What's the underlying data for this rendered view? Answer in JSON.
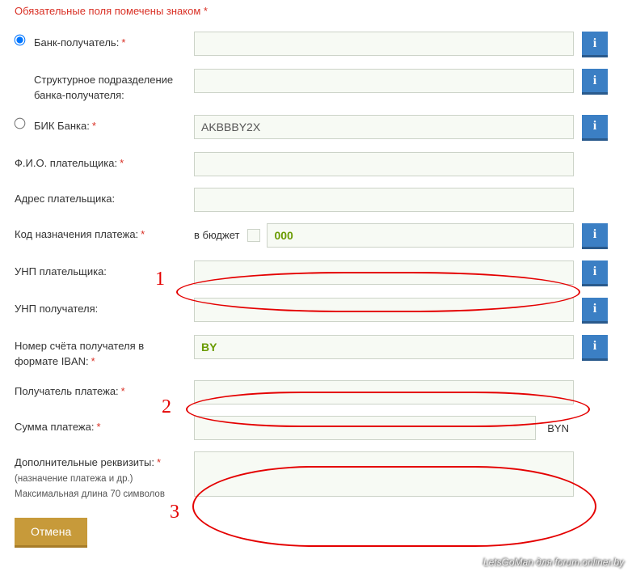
{
  "required_note": "Обязательные поля помечены знаком *",
  "fields": {
    "bank_recipient": {
      "label": "Банк-получатель:",
      "value": ""
    },
    "bank_subdiv": {
      "label": "Структурное подразделение банка-получателя:",
      "value": ""
    },
    "bik": {
      "label": "БИК Банка:",
      "value": "AKBBBY2X"
    },
    "payer_fio": {
      "label": "Ф.И.О. плательщика:",
      "value": ""
    },
    "payer_addr": {
      "label": "Адрес плательщика:",
      "value": ""
    },
    "purpose_code": {
      "label": "Код назначения платежа:",
      "budget_label": "в бюджет",
      "budget_checked": false,
      "value": "000"
    },
    "payer_unp": {
      "label": "УНП плательщика:",
      "value": ""
    },
    "recipient_unp": {
      "label": "УНП получателя:",
      "value": ""
    },
    "iban": {
      "label": "Номер счёта получателя в формате IBAN:",
      "value": "BY"
    },
    "payment_recipient": {
      "label": "Получатель платежа:",
      "value": ""
    },
    "amount": {
      "label": "Сумма платежа:",
      "value": "",
      "currency": "BYN"
    },
    "extra": {
      "label": "Дополнительные реквизиты:",
      "hint1": "(назначение платежа и др.)",
      "hint2": "Максимальная длина 70 символов",
      "value": ""
    }
  },
  "buttons": {
    "cancel": "Отмена",
    "info": "i"
  },
  "watermark": "LetsGoMan для forum.onliner.by",
  "annotations": {
    "n1": "1",
    "n2": "2",
    "n3": "3"
  }
}
